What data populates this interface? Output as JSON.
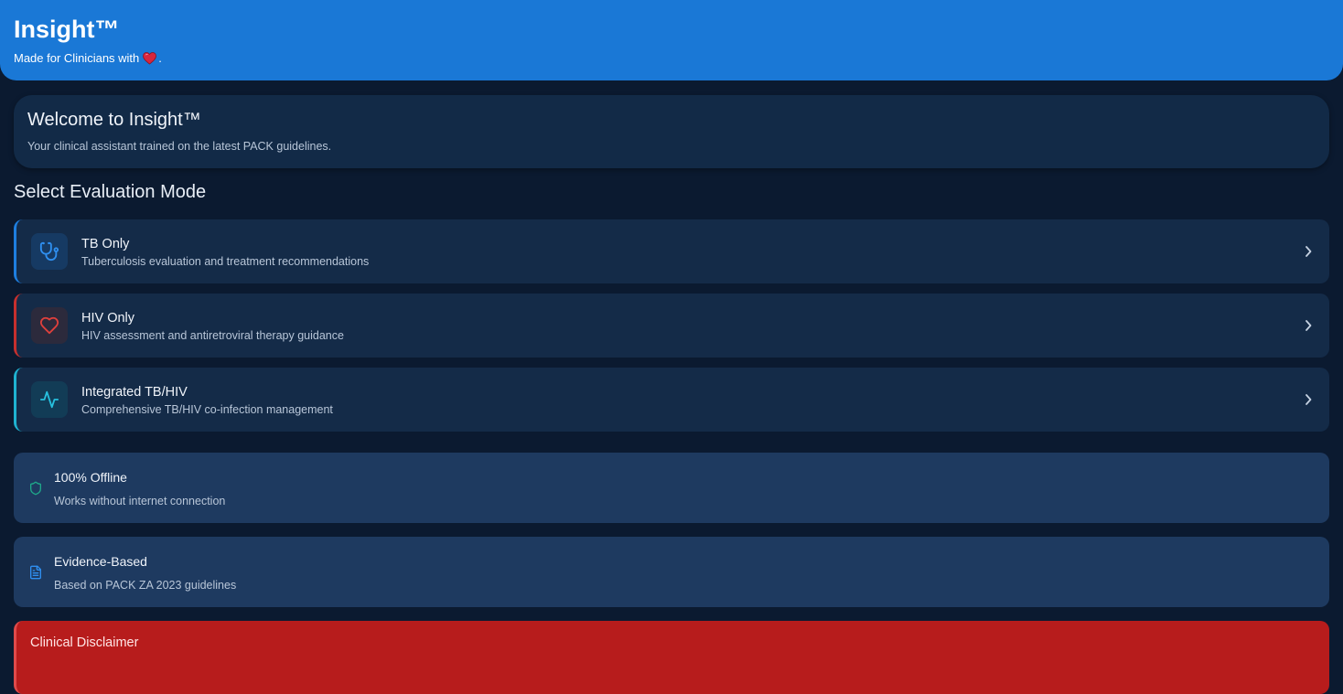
{
  "header": {
    "title": "Insight™",
    "tagline_prefix": "Made for Clinicians with",
    "tagline_suffix": "."
  },
  "welcome": {
    "title": "Welcome to Insight™",
    "subtitle": "Your clinical assistant trained on the latest PACK guidelines."
  },
  "section": {
    "title": "Select Evaluation Mode"
  },
  "modes": [
    {
      "title": "TB Only",
      "description": "Tuberculosis evaluation and treatment recommendations",
      "icon": "stethoscope-icon",
      "accent": "#1e7fe0"
    },
    {
      "title": "HIV Only",
      "description": "HIV assessment and antiretroviral therapy guidance",
      "icon": "heart-icon",
      "accent": "#c7302e"
    },
    {
      "title": "Integrated TB/HIV",
      "description": "Comprehensive TB/HIV co-infection management",
      "icon": "activity-icon",
      "accent": "#1fb3d1"
    }
  ],
  "features": [
    {
      "title": "100% Offline",
      "description": "Works without internet connection",
      "icon": "shield-icon",
      "accent": "#1fa88a"
    },
    {
      "title": "Evidence-Based",
      "description": "Based on PACK ZA 2023 guidelines",
      "icon": "document-icon",
      "accent": "#1e7fe0"
    }
  ],
  "disclaimer": {
    "title": "Clinical Disclaimer"
  },
  "colors": {
    "header_bg": "#1a78d6",
    "page_bg": "#0b1a30",
    "card_bg": "#142b48",
    "disclaimer_bg": "#b71c1c"
  }
}
